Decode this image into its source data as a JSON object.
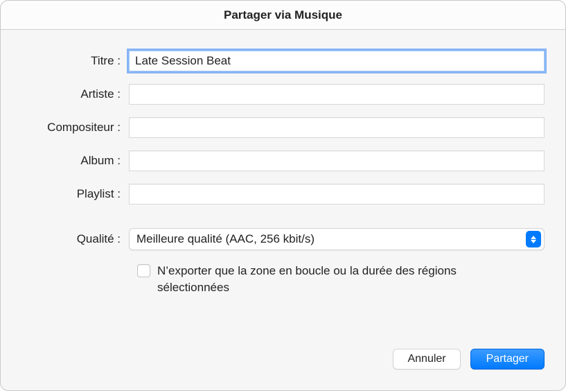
{
  "window": {
    "title": "Partager via Musique"
  },
  "form": {
    "title_label": "Titre :",
    "title_value": "Late Session Beat",
    "artist_label": "Artiste :",
    "artist_value": "",
    "composer_label": "Compositeur :",
    "composer_value": "",
    "album_label": "Album :",
    "album_value": "",
    "playlist_label": "Playlist :",
    "playlist_value": "",
    "quality_label": "Qualité :",
    "quality_value": "Meilleure qualité (AAC, 256 kbit/s)",
    "export_checkbox_checked": false,
    "export_checkbox_label": "N’exporter que la zone en boucle ou la durée des régions sélectionnées"
  },
  "buttons": {
    "cancel": "Annuler",
    "share": "Partager"
  }
}
